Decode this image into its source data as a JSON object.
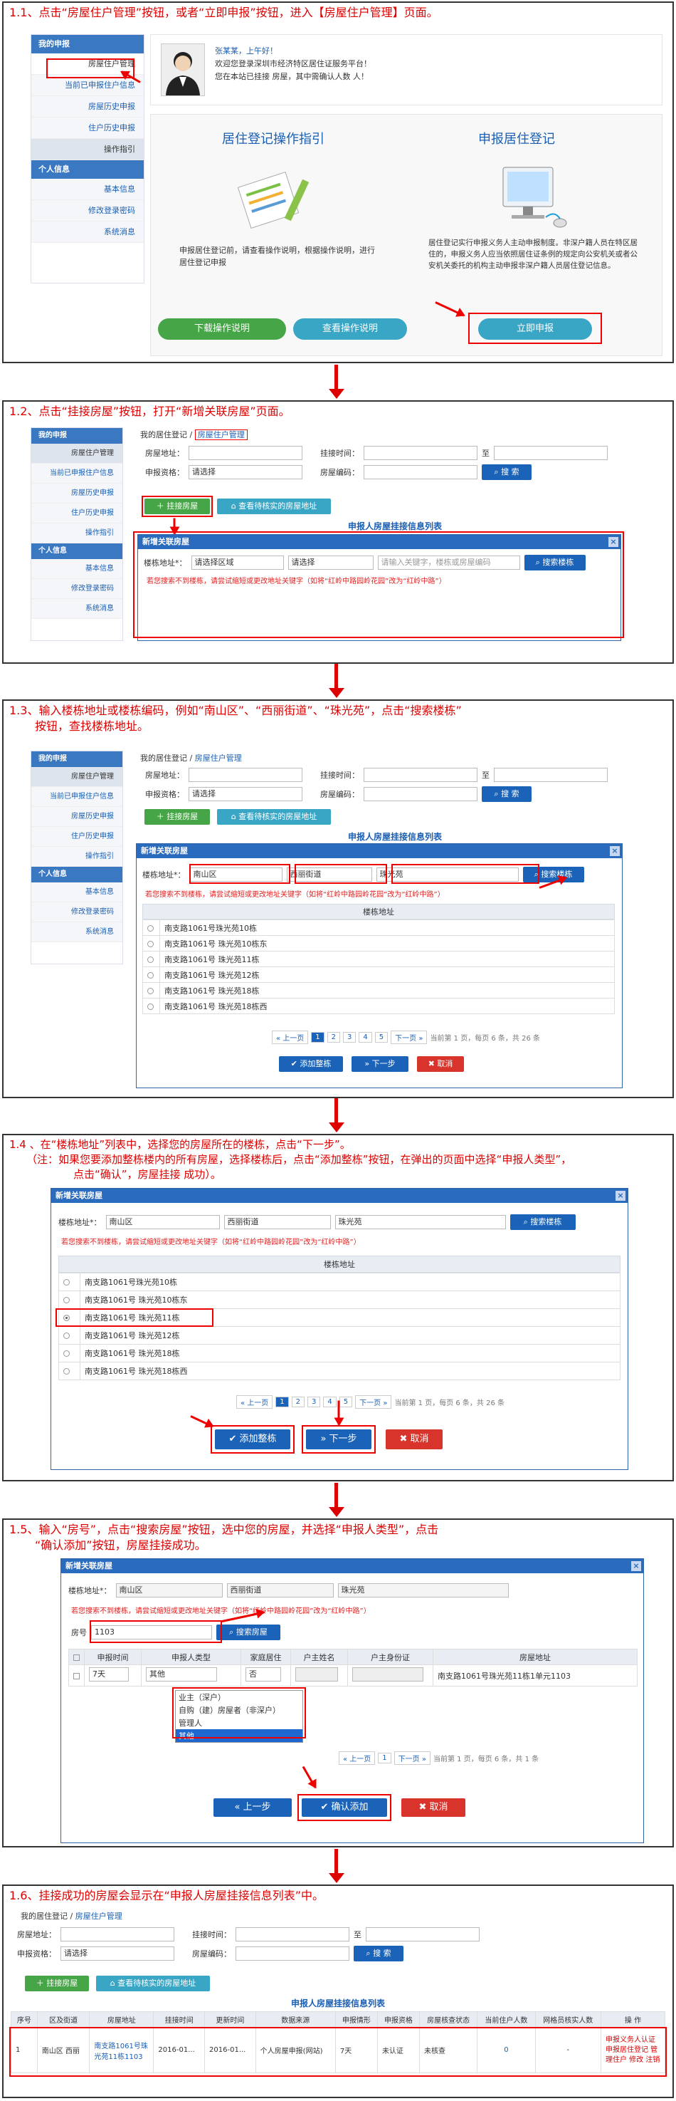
{
  "steps": {
    "s1": "1.1、点击“房屋住户管理”按钮，或者“立即申报”按钮，进入【房屋住户管理】页面。",
    "s2": "1.2、点击“挂接房屋”按钮，打开“新增关联房屋”页面。",
    "s3a": "1.3、输入楼栋地址或楼栋编码，例如“南山区”、“西丽街道”、“珠光苑”，点击“搜索楼栋”",
    "s3b": "按钮，查找楼栋地址。",
    "s4a": "1.4 、在“楼栋地址”列表中，选择您的房屋所在的楼栋，点击“下一步”。",
    "s4b": "（注：如果您要添加整栋楼内的所有房屋，选择楼栋后，点击“添加整栋”按钮，在弹出的页面中选择“申报人类型”，",
    "s4c": "点击“确认”，房屋挂接 成功）。",
    "s5a": "1.5、输入“房号”，点击“搜索房屋”按钮，选中您的房屋，并选择“申报人类型”，点击",
    "s5b": "“确认添加”按钮，房屋挂接成功。",
    "s6": "1.6、挂接成功的房屋会显示在“申报人房屋挂接信息列表”中。"
  },
  "side": {
    "my": "我的申报",
    "items": [
      "房屋住户管理",
      "当前已申报住户信息",
      "房屋历史申报",
      "住户历史申报",
      "操作指引"
    ],
    "personal": "个人信息",
    "pitems": [
      "基本信息",
      "修改登录密码",
      "系统消息"
    ]
  },
  "welcome": {
    "name": "张某某，上午好！",
    "line1": "欢迎您登录深圳市经济特区居住证服务平台！",
    "line2": "您在本站已挂接    房屋，其中需确认人数    人！"
  },
  "guide": {
    "title": "居住登记操作指引",
    "text": "申报居住登记前，请查看操作说明，根据操作说明，进行居住登记申报",
    "download": "下载操作说明",
    "view": "查看操作说明"
  },
  "report": {
    "title": "申报居住登记",
    "text": "居住登记实行申报义务人主动申报制度。非深户籍人员在特区居住的，申报义务人应当依照居住证条例的规定向公安机关或者公安机关委托的机构主动申报非深户籍人员居住登记信息。",
    "now": "立即申报"
  },
  "form": {
    "bread_home": "我的居住登记",
    "bread_cur": "房屋住户管理",
    "addr": "房屋地址：",
    "time": "挂接时间：",
    "to": "至",
    "qual": "申报资格：",
    "qual_val": "请选择",
    "code": "房屋编码：",
    "search": "搜 索",
    "attach": "挂接房屋",
    "pending": "查看待核实的房屋地址",
    "list_title": "申报人房屋挂接信息列表",
    "state": "状态",
    "count": "数",
    "net": "网格"
  },
  "dialog": {
    "title": "新增关联房屋",
    "bld_label": "楼栋地址*：",
    "district_ph": "请选择区域",
    "street_ph": "请选择",
    "kw_ph": "请输入关键字，楼栋或房屋编码",
    "district": "南山区",
    "street": "西丽街道",
    "kw": "珠光苑",
    "search_bld": "搜索楼栋",
    "warn": "若您搜索不到楼栋，请尝试缩短或更改地址关键字（如将“红岭中路园岭花园”改为“红岭中路”）",
    "bld_head": "楼栋地址",
    "buildings": [
      "南支路1061号珠光苑10栋",
      "南支路1061号 珠光苑10栋东",
      "南支路1061号 珠光苑11栋",
      "南支路1061号 珠光苑12栋",
      "南支路1061号 珠光苑18栋",
      "南支路1061号 珠光苑18栋西"
    ],
    "prev": "« 上一页",
    "next": "下一页 »",
    "pages": [
      "1",
      "2",
      "3",
      "4",
      "5"
    ],
    "pageinfo": "当前第  1  页，每页  6  条，共 26 条",
    "add_whole": "添加整栋",
    "next_step": "下一步",
    "cancel": "取消"
  },
  "dialog5": {
    "room_label": "房号",
    "room_val": "1103",
    "search_room": "搜索房屋",
    "cols": [
      "申报时间",
      "申报人类型",
      "家庭居住",
      "户主姓名",
      "户主身份证",
      "房屋地址"
    ],
    "time_val": "7天",
    "type_val": "其他",
    "family_val": "否",
    "addr_val": "南支路1061号珠光苑11栋1单元1103",
    "options": [
      "业主（深户）",
      "自购（建）房屋者（非深户）",
      "管理人",
      "其他"
    ],
    "pager_prev": "« 上一页",
    "pager_next": "下一页 »",
    "pager_page": "1",
    "pageinfo": "当前第  1  页，每页  6  条，共 1 条",
    "prev_step": "上一步",
    "confirm": "确认添加",
    "cancel": "取消"
  },
  "result": {
    "cols": [
      "序号",
      "区及街道",
      "房屋地址",
      "挂接时间",
      "更新时间",
      "数据来源",
      "申报情形",
      "申报资格",
      "房屋核查状态",
      "当前住户人数",
      "网格员核实人数",
      "操 作"
    ],
    "row": [
      "1",
      "南山区 西丽",
      "南支路1061号珠光苑11栋1103",
      "2016-01...",
      "2016-01...",
      "个人房屋申报(网站)",
      "7天",
      "未认证",
      "未核查",
      "0",
      "-"
    ],
    "ops": "申报义务人认证 申报居住登记 管理住户 修改 注销"
  }
}
